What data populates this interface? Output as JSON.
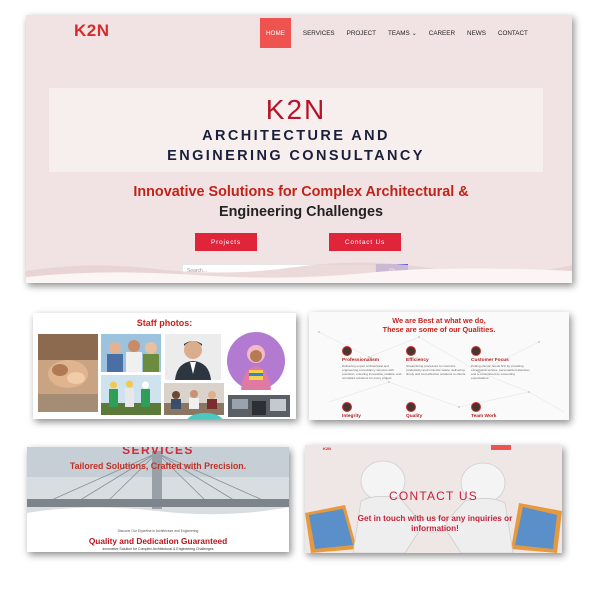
{
  "hero": {
    "logo": "K2N",
    "nav": [
      {
        "label": "HOME",
        "active": true
      },
      {
        "label": "SERVICES"
      },
      {
        "label": "PROJECT"
      },
      {
        "label": "TEAMS",
        "dropdown": true
      },
      {
        "label": "CAREER"
      },
      {
        "label": "NEWS"
      },
      {
        "label": "CONTACT"
      }
    ],
    "brand": "K2N",
    "subtitle_line1": "ARCHITECTURE AND",
    "subtitle_line2": "ENGINERING CONSULTANCY",
    "tagline_part1": "Innovative Solutions for Complex Architectural &",
    "tagline_part2": "Engineering Challenges",
    "projects_button": "Projects",
    "contact_button": "Contact Us",
    "search_placeholder": "Search..."
  },
  "staff": {
    "heading": "Staff photos:"
  },
  "qualities": {
    "heading_line1": "We are Best at what we do,",
    "heading_line2": "These are some of our Qualities.",
    "items": [
      {
        "title": "Professionalism",
        "text": "Delivering expert architectural and engineering consultancy services with precision, ensuring innovative, reliable, and compliant solutions for every project."
      },
      {
        "title": "Efficiency",
        "text": "Streamlining processes to maximize productivity and minimize waste, delivering timely and cost-effective solutions to clients."
      },
      {
        "title": "Customer Focus",
        "text": "Putting clients' needs first by providing exceptional service, personalized attention, and a commitment to exceeding expectations."
      },
      {
        "title": "Integrity"
      },
      {
        "title": "Quality"
      },
      {
        "title": "Team Work"
      }
    ]
  },
  "services": {
    "heading": "SERVICES",
    "tagline": "Tailored Solutions, Crafted with Precision.",
    "discover": "Discover Our Expertise in Architecture and Engineering",
    "quality_heading": "Quality and Dedication Guaranteed",
    "innovative": "Innovative Solution for Complex Architectural & Engineering Challenges"
  },
  "contact": {
    "mini_logo": "K2N",
    "title": "CONTACT US",
    "text": "Get in touch with us for any inquiries or information!"
  },
  "colors": {
    "accent_red": "#e0243a",
    "nav_active": "#ef5350",
    "brand_red": "#b5152b",
    "search_button": "#5c5ce0"
  }
}
